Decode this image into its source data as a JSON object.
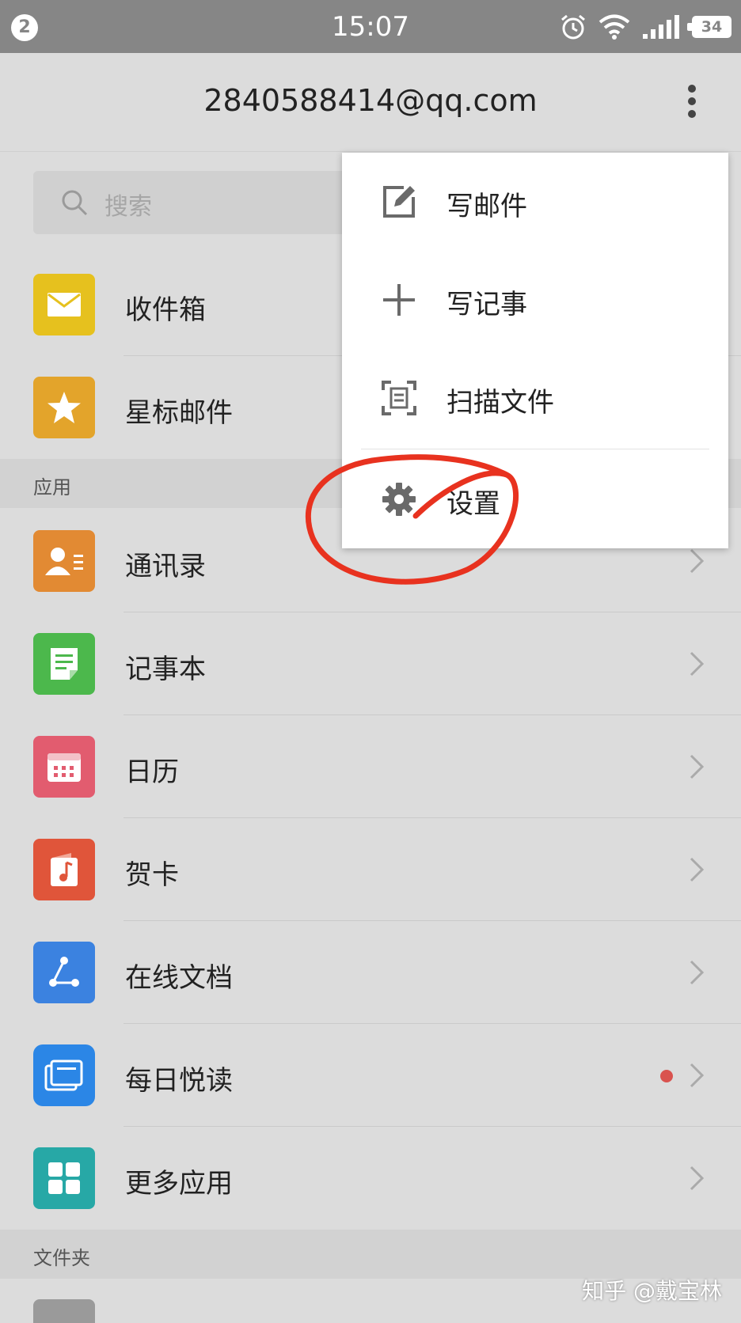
{
  "status_bar": {
    "notification_count": "2",
    "time": "15:07",
    "battery": "34",
    "icons": [
      "alarm-icon",
      "wifi-icon",
      "signal-icon",
      "battery-icon"
    ]
  },
  "header": {
    "title": "2840588414@qq.com",
    "menu_icon": "more-vertical-icon"
  },
  "search": {
    "placeholder": "搜索"
  },
  "mailboxes": [
    {
      "label": "收件箱",
      "icon": "envelope-icon",
      "color": "#e6c11e"
    },
    {
      "label": "星标邮件",
      "icon": "star-icon",
      "color": "#e3a42b"
    }
  ],
  "sections": {
    "apps": "应用",
    "folders": "文件夹"
  },
  "apps": [
    {
      "label": "通讯录",
      "icon": "contacts-icon",
      "color": "#e28a33"
    },
    {
      "label": "记事本",
      "icon": "notebook-icon",
      "color": "#4cb84c"
    },
    {
      "label": "日历",
      "icon": "calendar-icon",
      "color": "#e25c6f"
    },
    {
      "label": "贺卡",
      "icon": "music-card-icon",
      "color": "#e0553a"
    },
    {
      "label": "在线文档",
      "icon": "share-doc-icon",
      "color": "#3b82e0"
    },
    {
      "label": "每日悦读",
      "icon": "reading-icon",
      "color": "#2b86e6",
      "badge": true
    },
    {
      "label": "更多应用",
      "icon": "apps-grid-icon",
      "color": "#27a8a6"
    }
  ],
  "popup_menu": [
    {
      "label": "写邮件",
      "icon": "compose-icon"
    },
    {
      "label": "写记事",
      "icon": "plus-icon"
    },
    {
      "label": "扫描文件",
      "icon": "scan-icon"
    },
    {
      "label": "设置",
      "icon": "gear-icon"
    }
  ],
  "annotation": {
    "color": "#e8321f"
  },
  "watermark": "知乎 @戴宝林"
}
